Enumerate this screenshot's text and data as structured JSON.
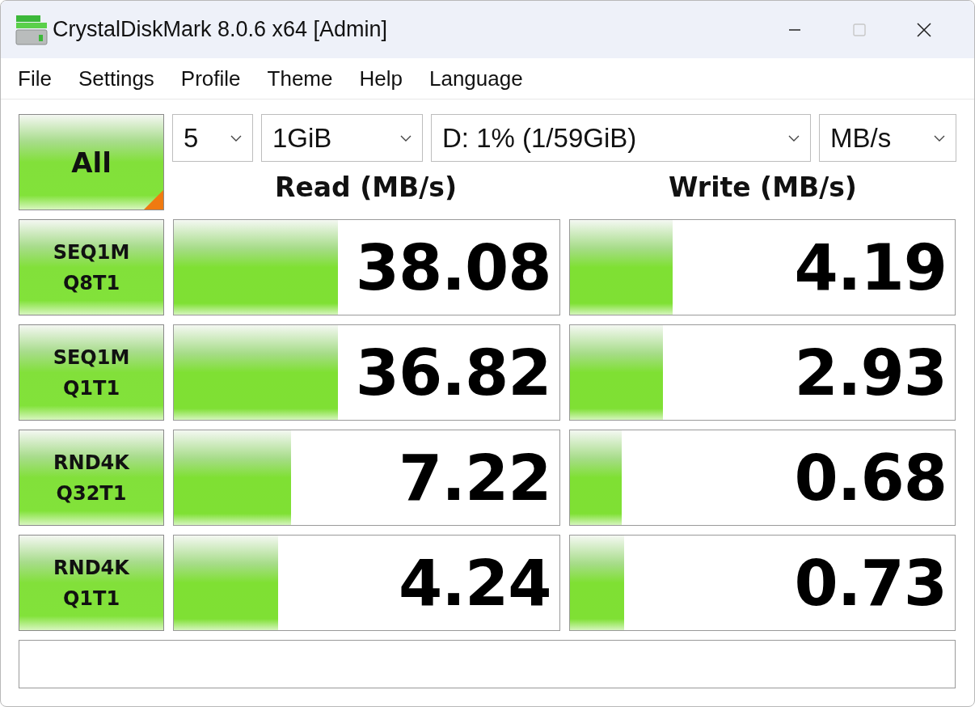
{
  "window": {
    "title": "CrystalDiskMark 8.0.6 x64 [Admin]",
    "maximize_disabled": true
  },
  "menu": [
    "File",
    "Settings",
    "Profile",
    "Theme",
    "Help",
    "Language"
  ],
  "all_button": {
    "label": "All"
  },
  "selectors": [
    {
      "kind": "count",
      "value": "5"
    },
    {
      "kind": "size",
      "value": "1GiB"
    },
    {
      "kind": "drive",
      "value": "D: 1% (1/59GiB)"
    },
    {
      "kind": "unit",
      "value": "MB/s"
    }
  ],
  "columns": [
    "Read (MB/s)",
    "Write (MB/s)"
  ],
  "tests": [
    {
      "line1": "SEQ1M",
      "line2": "Q8T1",
      "read": {
        "value": "38.08",
        "level": 0.427
      },
      "write": {
        "value": "4.19",
        "level": 0.268
      }
    },
    {
      "line1": "SEQ1M",
      "line2": "Q1T1",
      "read": {
        "value": "36.82",
        "level": 0.425
      },
      "write": {
        "value": "2.93",
        "level": 0.243
      }
    },
    {
      "line1": "RND4K",
      "line2": "Q32T1",
      "read": {
        "value": "7.22",
        "level": 0.305
      },
      "write": {
        "value": "0.68",
        "level": 0.136
      }
    },
    {
      "line1": "RND4K",
      "line2": "Q1T1",
      "read": {
        "value": "4.24",
        "level": 0.27
      },
      "write": {
        "value": "0.73",
        "level": 0.142
      }
    }
  ]
}
